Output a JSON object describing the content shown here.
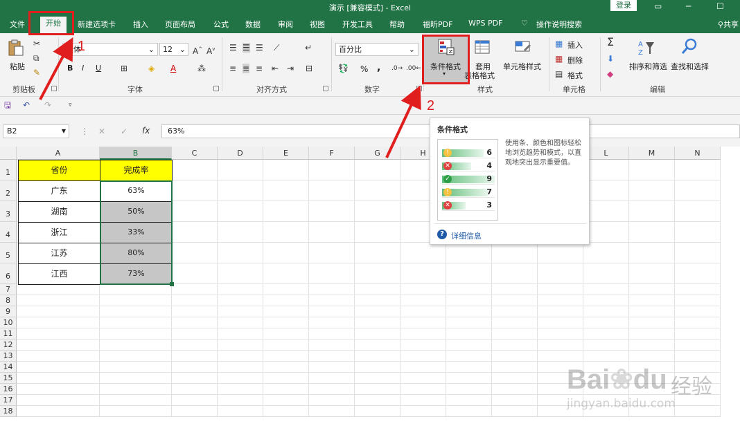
{
  "window": {
    "title": "演示  [兼容模式]  -  Excel",
    "login_label": "登录",
    "share_label": "共享"
  },
  "tabs": [
    "文件",
    "开始",
    "新建选项卡",
    "插入",
    "页面布局",
    "公式",
    "数据",
    "审阅",
    "视图",
    "开发工具",
    "帮助",
    "福昕PDF",
    "WPS PDF"
  ],
  "active_tab": "开始",
  "tell_me": "操作说明搜索",
  "ribbon": {
    "clipboard": {
      "label": "剪贴板",
      "paste": "粘贴"
    },
    "font": {
      "label": "字体",
      "name": "宋体",
      "size": "12",
      "bold": "B",
      "italic": "I",
      "underline": "U"
    },
    "alignment": {
      "label": "对齐方式"
    },
    "number": {
      "label": "数字",
      "format": "百分比",
      "percent": "%",
      "comma": ","
    },
    "styles": {
      "label": "样式",
      "conditional": "条件格式",
      "table_format_1": "套用",
      "table_format_2": "表格格式",
      "cell_styles": "单元格样式"
    },
    "cells": {
      "label": "单元格",
      "insert": "插入",
      "delete": "删除",
      "format": "格式"
    },
    "editing": {
      "label": "编辑",
      "sort_filter": "排序和筛选",
      "find_select": "查找和选择"
    }
  },
  "name_box": "B2",
  "formula_value": "63%",
  "columns": [
    "A",
    "B",
    "C",
    "D",
    "E",
    "F",
    "G",
    "H",
    "I",
    "J",
    "K",
    "L",
    "M",
    "N"
  ],
  "selected_column": "B",
  "rows": [
    "1",
    "2",
    "3",
    "4",
    "5",
    "6",
    "7",
    "8",
    "9",
    "10",
    "11",
    "12",
    "13",
    "14",
    "15",
    "16",
    "17",
    "18"
  ],
  "table": {
    "headers": [
      "省份",
      "完成率"
    ],
    "rows": [
      [
        "广东",
        "63%"
      ],
      [
        "湖南",
        "50%"
      ],
      [
        "浙江",
        "33%"
      ],
      [
        "江苏",
        "80%"
      ],
      [
        "江西",
        "73%"
      ]
    ]
  },
  "colors": {
    "excel_green": "#217346",
    "header_fill": "#ffff00",
    "selection_fill": "#c6c6c6",
    "annotation_red": "#e01e1e"
  },
  "tooltip": {
    "title": "条件格式",
    "description": "使用条、颜色和图标轻松地浏览趋势和模式，以直观地突出显示重要值。",
    "preview_values": [
      "6",
      "4",
      "9",
      "7",
      "3"
    ],
    "preview_icons": [
      "warning",
      "error",
      "ok",
      "warning",
      "error"
    ],
    "more_info": "详细信息"
  },
  "annotations": {
    "step1": "1",
    "step2": "2"
  },
  "watermark": {
    "brand": "Bai",
    "brand2": "du",
    "cn": "经验",
    "url": "jingyan.baidu.com"
  }
}
